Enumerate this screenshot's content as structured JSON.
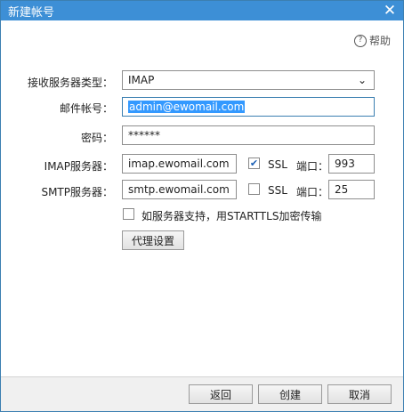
{
  "window": {
    "title": "新建帐号",
    "close_glyph": "✕"
  },
  "help": {
    "icon": "?",
    "label": "帮助"
  },
  "form": {
    "type_label": "接收服务器类型：",
    "type_value": "IMAP",
    "account_label": "邮件帐号：",
    "account_value": "admin@ewomail.com",
    "password_label": "密码：",
    "password_value": "******",
    "imap_label": "IMAP服务器：",
    "imap_value": "imap.ewomail.com",
    "imap_ssl_label": "SSL",
    "imap_ssl_checked": true,
    "imap_port_label": "端口：",
    "imap_port_value": "993",
    "smtp_label": "SMTP服务器：",
    "smtp_value": "smtp.ewomail.com",
    "smtp_ssl_label": "SSL",
    "smtp_ssl_checked": false,
    "smtp_port_label": "端口：",
    "smtp_port_value": "25",
    "starttls_label": "如服务器支持，用STARTTLS加密传输",
    "starttls_checked": false,
    "proxy_button": "代理设置"
  },
  "footer": {
    "back": "返回",
    "create": "创建",
    "cancel": "取消"
  }
}
